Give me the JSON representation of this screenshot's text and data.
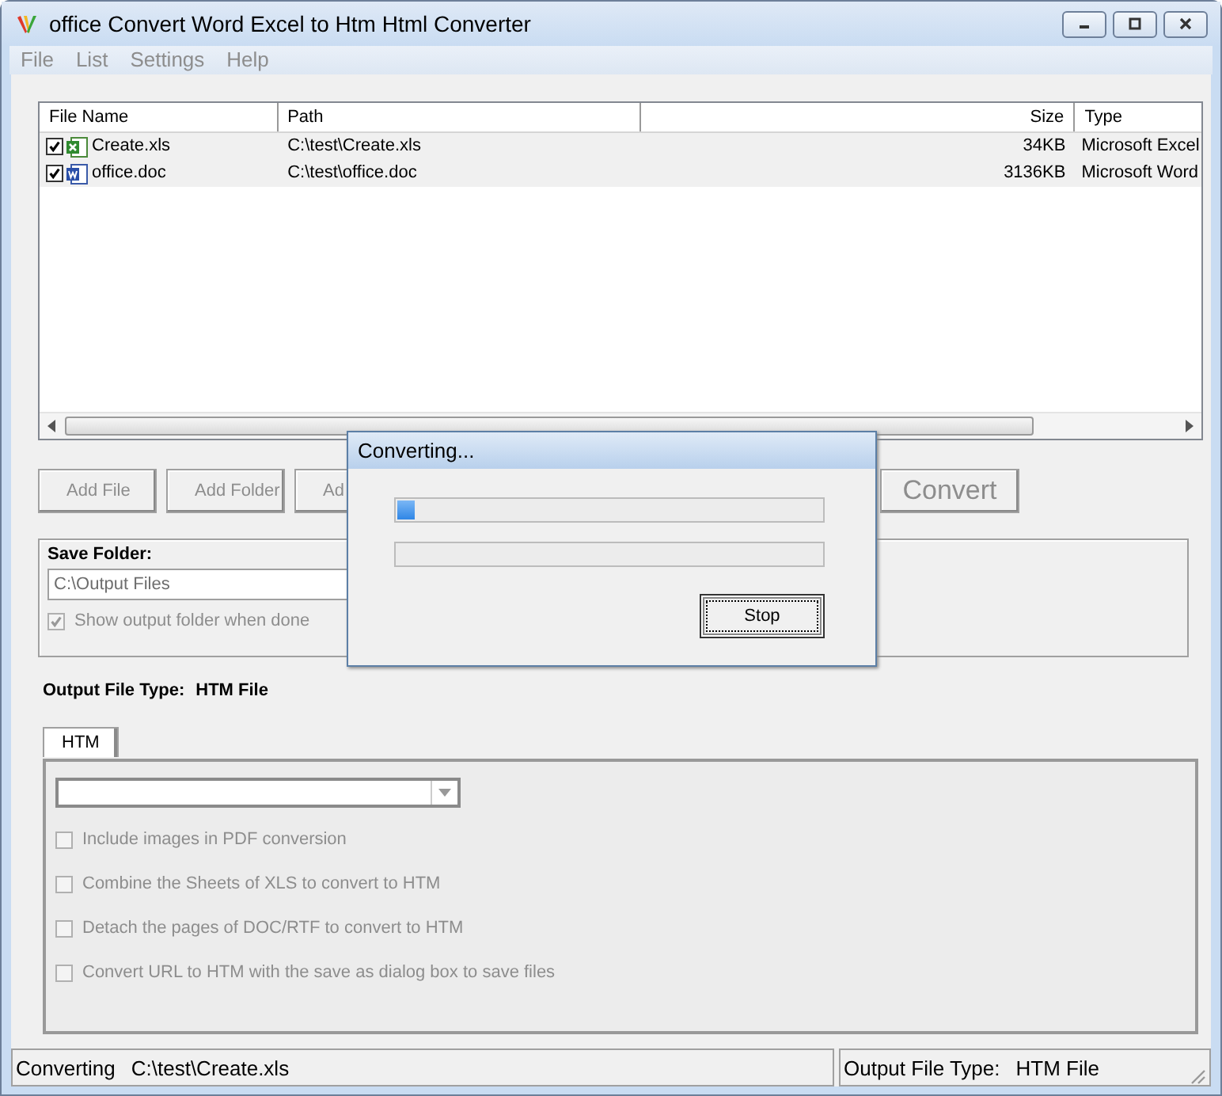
{
  "window": {
    "title": "office Convert Word Excel to Htm Html Converter"
  },
  "menu": [
    {
      "label": "File",
      "disabled": true
    },
    {
      "label": "List",
      "disabled": true
    },
    {
      "label": "Settings",
      "disabled": true
    },
    {
      "label": "Help",
      "disabled": true
    }
  ],
  "file_list": {
    "columns": [
      {
        "label": "File Name",
        "kind": "text"
      },
      {
        "label": "Path",
        "kind": "text"
      },
      {
        "label": "Size",
        "kind": "number"
      },
      {
        "label": "Type",
        "kind": "text"
      }
    ],
    "rows": [
      {
        "checked": true,
        "kind": "spreadsheet",
        "cells": [
          "Create.xls",
          "C:\\test\\Create.xls",
          "34KB",
          "Microsoft Excel"
        ]
      },
      {
        "checked": true,
        "kind": "document",
        "cells": [
          "office.doc",
          "C:\\test\\office.doc",
          "3136KB",
          "Microsoft Word"
        ]
      }
    ]
  },
  "buttons": [
    {
      "label": "Add File",
      "kind": "normal",
      "disabled": true
    },
    {
      "label": "Add Folder",
      "kind": "normal",
      "disabled": true
    },
    {
      "label": "Ad",
      "kind": "normal",
      "disabled": true
    },
    {
      "label": "Convert",
      "kind": "large",
      "disabled": true
    }
  ],
  "save_folder": {
    "label": "Save Folder:",
    "value": "C:\\Output Files",
    "show_when_done": {
      "label": "Show output folder when done",
      "checked": true,
      "disabled": true
    }
  },
  "output_type": {
    "label": "Output File Type:",
    "value": "HTM File"
  },
  "tabs": [
    {
      "label": "HTM",
      "selected": true
    }
  ],
  "options": [
    {
      "label": "Include images in PDF conversion",
      "checked": false,
      "disabled": true
    },
    {
      "label": "Combine the Sheets of XLS to convert to HTM",
      "checked": false,
      "disabled": true
    },
    {
      "label": "Detach the pages of DOC/RTF to convert to HTM",
      "checked": false,
      "disabled": true
    },
    {
      "label": "Convert URL to HTM with the save as dialog box to save files",
      "checked": false,
      "disabled": true
    }
  ],
  "status_bar": {
    "state": "Converting",
    "file": "C:\\test\\Create.xls",
    "type_label": "Output File Type:",
    "type_value": "HTM File"
  },
  "dialog": {
    "title": "Converting...",
    "progress": [
      {
        "level": 0.04
      },
      {
        "level": 0
      }
    ],
    "button": "Stop"
  }
}
